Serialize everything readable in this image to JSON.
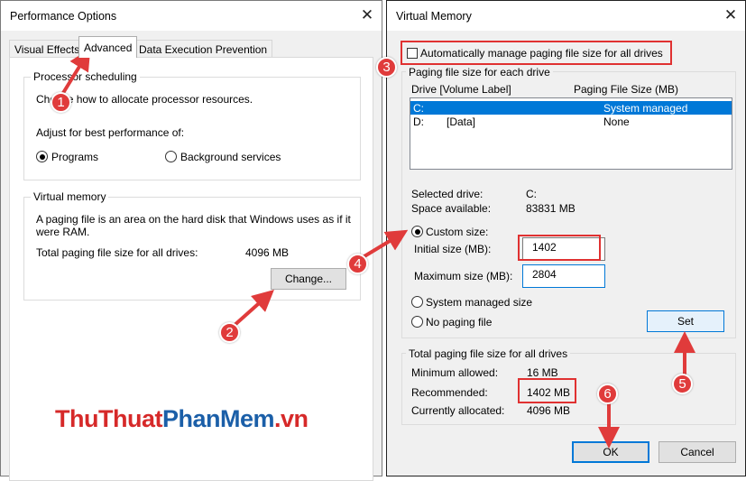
{
  "colors": {
    "accent": "#0078d7",
    "annotation": "#e03131",
    "watermark_red": "#d62929",
    "watermark_blue": "#1b5fa8"
  },
  "perf": {
    "title": "Performance Options",
    "tabs": [
      {
        "label": "Visual Effects"
      },
      {
        "label": "Advanced"
      },
      {
        "label": "Data Execution Prevention"
      }
    ],
    "scheduling": {
      "title": "Processor scheduling",
      "desc": "Choose how to allocate processor resources.",
      "adjust_label": "Adjust for best performance of:",
      "programs_label": "Programs",
      "background_label": "Background services"
    },
    "vm": {
      "title": "Virtual memory",
      "desc_line1": "A paging file is an area on the hard disk that Windows uses as if it",
      "desc_line2": "were RAM.",
      "total_label": "Total paging file size for all drives:",
      "total_value": "4096 MB",
      "change_label": "Change..."
    }
  },
  "vmdlg": {
    "title": "Virtual Memory",
    "auto_manage_label": "Automatically manage paging file size for all drives",
    "each_drive_title": "Paging file size for each drive",
    "col_drive": "Drive  [Volume Label]",
    "col_size": "Paging File Size (MB)",
    "drives": [
      {
        "drive": "C:",
        "label": "",
        "size": "System managed"
      },
      {
        "drive": "D:",
        "label": "[Data]",
        "size": "None"
      }
    ],
    "selected_drive_label": "Selected drive:",
    "selected_drive_value": "C:",
    "space_label": "Space available:",
    "space_value": "83831 MB",
    "custom_size_label": "Custom size:",
    "initial_label": "Initial size (MB):",
    "initial_value": "1402",
    "max_label": "Maximum size (MB):",
    "max_value": "2804",
    "system_managed_label": "System managed size",
    "no_paging_label": "No paging file",
    "set_label": "Set",
    "total_title": "Total paging file size for all drives",
    "min_label": "Minimum allowed:",
    "min_value": "16 MB",
    "rec_label": "Recommended:",
    "rec_value": "1402 MB",
    "cur_label": "Currently allocated:",
    "cur_value": "4096 MB",
    "ok_label": "OK",
    "cancel_label": "Cancel"
  },
  "annotations": [
    "1",
    "2",
    "3",
    "4",
    "5",
    "6"
  ],
  "watermark": {
    "part1": "ThuThuat",
    "part2": "PhanMem",
    "part3": ".vn"
  }
}
